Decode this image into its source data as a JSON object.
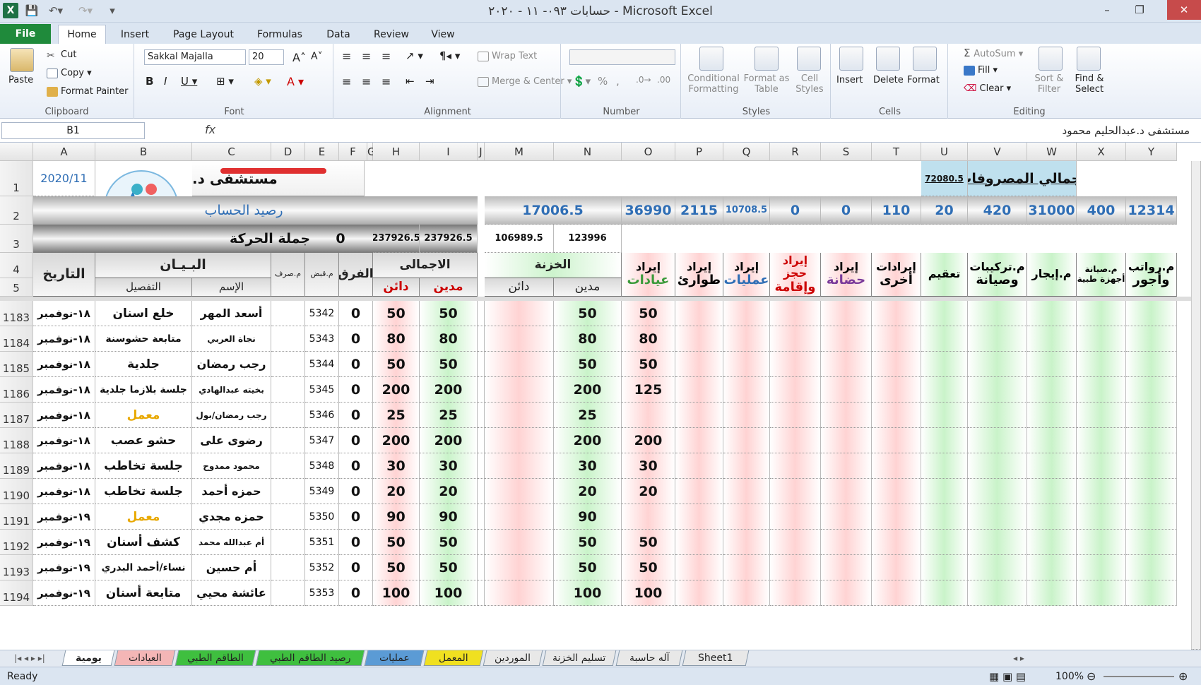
{
  "window": {
    "title": "حسابات ٠٩٣- ١١ - ٢٠٢٠ - Microsoft Excel",
    "minimize": "–",
    "restore": "❐",
    "close": "✕"
  },
  "menu_tabs": [
    "File",
    "Home",
    "Insert",
    "Page Layout",
    "Formulas",
    "Data",
    "Review",
    "View"
  ],
  "ribbon": {
    "clipboard": {
      "label": "Clipboard",
      "paste": "Paste",
      "cut": "Cut",
      "copy": "Copy",
      "format_painter": "Format Painter"
    },
    "font": {
      "label": "Font",
      "family": "Sakkal Majalla",
      "size": "20"
    },
    "alignment": {
      "label": "Alignment",
      "wrap": "Wrap Text",
      "merge": "Merge & Center"
    },
    "number": {
      "label": "Number",
      "format": ""
    },
    "styles": {
      "label": "Styles",
      "conditional": "Conditional Formatting",
      "format_table": "Format as Table",
      "cell_styles": "Cell Styles"
    },
    "cells": {
      "label": "Cells",
      "insert": "Insert",
      "delete": "Delete",
      "format": "Format"
    },
    "editing": {
      "label": "Editing",
      "autosum": "AutoSum",
      "fill": "Fill",
      "clear": "Clear",
      "sort": "Sort & Filter",
      "find": "Find & Select"
    }
  },
  "formula_bar": {
    "name_box": "B1",
    "fx": "fx",
    "content": "مستشفى د.عبدالحليم محمود"
  },
  "columns": [
    "A",
    "B",
    "C",
    "D",
    "E",
    "F",
    "G",
    "H",
    "I",
    "J",
    "M",
    "N",
    "O",
    "P",
    "Q",
    "R",
    "S",
    "T",
    "U",
    "V",
    "W",
    "X",
    "Y"
  ],
  "top": {
    "date": "2020/11",
    "title": "مستشفى د.",
    "balance_label": "رصيد الحساب",
    "movement_label": "جملة الحركة",
    "movement_value": "0",
    "h3": "237926.5",
    "i3": "237926.5",
    "m3": "106989.5",
    "n3": "123996",
    "expenses_label": "إجمالي المصروفات",
    "expenses_value": "72080.5",
    "row2": {
      "M": "17006.5",
      "O": "36990",
      "P": "2115",
      "Q": "10708.5",
      "R": "0",
      "S": "0",
      "T": "110",
      "U": "20",
      "V": "420",
      "W": "31000",
      "X": "400",
      "Y": "12314"
    }
  },
  "headers": {
    "date": "التاريخ",
    "statement": "البـيـان",
    "detail": "التفصيل",
    "name": "الإسم",
    "exp_no": "م.صرف",
    "rcpt_no": "م.قبض",
    "diff": "الفرق",
    "total": "الاجمالى",
    "credit": "دائن",
    "debit": "مدين",
    "treasury": "الخزنة",
    "treasury_credit": "دائن",
    "treasury_debit": "مدين",
    "O": [
      "إيراد",
      "عيادات"
    ],
    "P": [
      "إيراد",
      "طوارئ"
    ],
    "Q": [
      "إيراد",
      "عمليات"
    ],
    "R": [
      "إيراد حجز",
      "وإقامة"
    ],
    "S": [
      "إيراد",
      "حضانة"
    ],
    "T": [
      "إيرادات",
      "أخرى"
    ],
    "U": [
      "تعقيم",
      ""
    ],
    "V": [
      "م.تركيبات",
      "وصيانة"
    ],
    "W": [
      "م.إيجار",
      ""
    ],
    "X": [
      "م.صيانة",
      "أجهزة طبية"
    ],
    "Y": [
      "م.رواتب",
      "وأجور"
    ]
  },
  "rows": [
    {
      "n": "1183",
      "date": "١٨-نوفمبر",
      "detail": "خلع اسنان",
      "name": "أسعد المهر",
      "rcpt": "5342",
      "diff": "0",
      "h": "50",
      "i": "50",
      "n_": "50",
      "o": "50"
    },
    {
      "n": "1184",
      "date": "١٨-نوفمبر",
      "detail": "متابعة حشوسنة",
      "name": "نجاة العربي",
      "rcpt": "5343",
      "diff": "0",
      "h": "80",
      "i": "80",
      "n_": "80",
      "o": "80"
    },
    {
      "n": "1185",
      "date": "١٨-نوفمبر",
      "detail": "جلدية",
      "name": "رجب رمضان",
      "rcpt": "5344",
      "diff": "0",
      "h": "50",
      "i": "50",
      "n_": "50",
      "o": "50"
    },
    {
      "n": "1186",
      "date": "١٨-نوفمبر",
      "detail": "جلسة بلازما جلدية",
      "name": "بخيته عبدالهادي",
      "rcpt": "5345",
      "diff": "0",
      "h": "200",
      "i": "200",
      "n_": "200",
      "o": "125"
    },
    {
      "n": "1187",
      "date": "١٨-نوفمبر",
      "detail": "معمل",
      "name": "رجب رمضان/بول",
      "rcpt": "5346",
      "diff": "0",
      "h": "25",
      "i": "25",
      "n_": "25",
      "o": ""
    },
    {
      "n": "1188",
      "date": "١٨-نوفمبر",
      "detail": "حشو عصب",
      "name": "رضوى على",
      "rcpt": "5347",
      "diff": "0",
      "h": "200",
      "i": "200",
      "n_": "200",
      "o": "200"
    },
    {
      "n": "1189",
      "date": "١٨-نوفمبر",
      "detail": "جلسة تخاطب",
      "name": "محمود ممدوح",
      "rcpt": "5348",
      "diff": "0",
      "h": "30",
      "i": "30",
      "n_": "30",
      "o": "30"
    },
    {
      "n": "1190",
      "date": "١٨-نوفمبر",
      "detail": "جلسة تخاطب",
      "name": "حمزه أحمد",
      "rcpt": "5349",
      "diff": "0",
      "h": "20",
      "i": "20",
      "n_": "20",
      "o": "20"
    },
    {
      "n": "1191",
      "date": "١٩-نوفمبر",
      "detail": "معمل",
      "name": "حمزه مجدي",
      "rcpt": "5350",
      "diff": "0",
      "h": "90",
      "i": "90",
      "n_": "90",
      "o": ""
    },
    {
      "n": "1192",
      "date": "١٩-نوفمبر",
      "detail": "كشف أسنان",
      "name": "أم عبدالله محمد",
      "rcpt": "5351",
      "diff": "0",
      "h": "50",
      "i": "50",
      "n_": "50",
      "o": "50"
    },
    {
      "n": "1193",
      "date": "١٩-نوفمبر",
      "detail": "نساء/أحمد البدري",
      "name": "أم حسين",
      "rcpt": "5352",
      "diff": "0",
      "h": "50",
      "i": "50",
      "n_": "50",
      "o": "50"
    },
    {
      "n": "1194",
      "date": "١٩-نوفمبر",
      "detail": "متابعة أسنان",
      "name": "عائشة محيي",
      "rcpt": "5353",
      "diff": "0",
      "h": "100",
      "i": "100",
      "n_": "100",
      "o": "100"
    }
  ],
  "sheets": [
    {
      "name": "يومية",
      "color": "#ffffff",
      "active": true
    },
    {
      "name": "العيادات",
      "color": "#f4b6b6"
    },
    {
      "name": "الطاقم الطبي",
      "color": "#3fbf3f"
    },
    {
      "name": "رصيد الطاقم الطبي",
      "color": "#3fbf3f"
    },
    {
      "name": "عمليات",
      "color": "#5b9bd5"
    },
    {
      "name": "المعمل",
      "color": "#f0e020"
    },
    {
      "name": "الموردين",
      "color": "#e8e8e8"
    },
    {
      "name": "تسليم الخزنة",
      "color": "#e8e8e8"
    },
    {
      "name": "آله حاسبة",
      "color": "#e8e8e8"
    },
    {
      "name": "Sheet1",
      "color": "#e8e8e8"
    }
  ],
  "status": {
    "ready": "Ready",
    "zoom": "100%"
  }
}
